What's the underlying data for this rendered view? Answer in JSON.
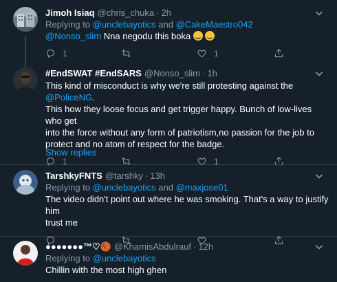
{
  "tweets": [
    {
      "name": "Jimoh Isiaq",
      "handle": "@chris_chuka",
      "time": "2h",
      "reply_prefix": "Replying to",
      "reply_users": [
        "@unclebayotics",
        "@CakeMaestro042"
      ],
      "reply_joiner": "and",
      "mention": "@Nonso_slim",
      "text": "Nna negodu this boka",
      "emojis": [
        "face-with-tears-of-joy",
        "loudly-crying-face"
      ],
      "reply_count": "1",
      "retweet_count": "",
      "like_count": "1"
    },
    {
      "name": "#EndSWAT #EndSARS",
      "handle": "@Nonso_slim",
      "time": "1h",
      "text_lines": [
        "This kind of misconduct is why we're still protesting against the ",
        "This how they loose focus and get trigger happy. Bunch of low-lives who get",
        "into the force without any form of patriotism,no passion for the job to",
        "protect and no atom of respect for the badge."
      ],
      "inline_link": "@PoliceNG",
      "inline_tail": ".",
      "reply_count": "1",
      "retweet_count": "",
      "like_count": "1",
      "show_replies": "Show replies"
    },
    {
      "name": "TarshkyFNTS",
      "handle": "@tarshky",
      "time": "13h",
      "reply_prefix": "Replying to",
      "reply_users": [
        "@unclebayotics",
        "@maxjose01"
      ],
      "reply_joiner": "and",
      "text_lines": [
        "The video didn't point out where he was smoking. That's a way to justify him",
        "trust me"
      ],
      "reply_count": "",
      "retweet_count": "",
      "like_count": ""
    },
    {
      "name": "●●●●●●●™♡🏀",
      "handle": "@KhamisAbdulrauf",
      "time": "12h",
      "reply_prefix": "Replying to",
      "reply_users": [
        "@unclebayotics"
      ],
      "text": "Chillin with the most high ghen"
    }
  ],
  "separator": "·",
  "colors": {
    "background": "#15202b",
    "text": "#ffffff",
    "secondary": "#8899a6",
    "link": "#1da1f2",
    "border": "#38444d"
  },
  "icons": [
    "reply-icon",
    "retweet-icon",
    "like-icon",
    "share-icon",
    "caret-down-icon"
  ]
}
